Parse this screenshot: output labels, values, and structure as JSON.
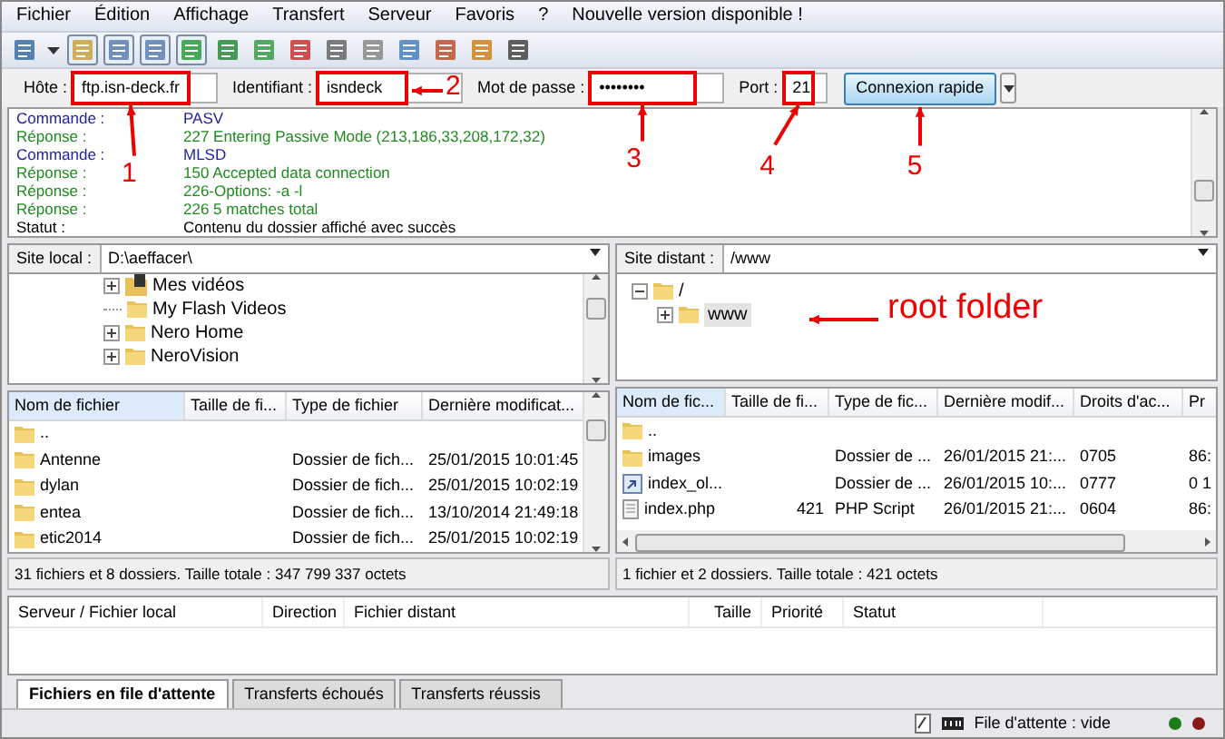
{
  "menu": [
    "Fichier",
    "Édition",
    "Affichage",
    "Transfert",
    "Serveur",
    "Favoris",
    "?",
    "Nouvelle version disponible !"
  ],
  "toolbar": [
    {
      "kind": "sitemanager",
      "on": false
    },
    {
      "kind": "dropdown",
      "on": false
    },
    {
      "kind": "log",
      "on": true
    },
    {
      "kind": "tree",
      "on": true
    },
    {
      "kind": "remotetree",
      "on": true
    },
    {
      "kind": "queue",
      "on": true
    },
    {
      "kind": "refresh",
      "on": false
    },
    {
      "kind": "process",
      "on": false
    },
    {
      "kind": "stop",
      "on": false
    },
    {
      "kind": "disconnect",
      "on": false
    },
    {
      "kind": "reconnect",
      "on": false
    },
    {
      "kind": "filter",
      "on": false
    },
    {
      "kind": "compare",
      "on": false
    },
    {
      "kind": "sync",
      "on": false
    },
    {
      "kind": "find",
      "on": false
    }
  ],
  "quickconnect": {
    "host": {
      "label": "Hôte :",
      "value": "ftp.isn-deck.fr"
    },
    "user": {
      "label": "Identifiant :",
      "value": "isndeck"
    },
    "password": {
      "label": "Mot de passe :",
      "value": "••••••••"
    },
    "port": {
      "label": "Port :",
      "value": "21"
    },
    "button": "Connexion rapide"
  },
  "log": [
    {
      "kind": "command",
      "label": "Commande :",
      "text": "PASV"
    },
    {
      "kind": "response",
      "label": "Réponse :",
      "text": "227 Entering Passive Mode (213,186,33,208,172,32)"
    },
    {
      "kind": "command",
      "label": "Commande :",
      "text": "MLSD"
    },
    {
      "kind": "response",
      "label": "Réponse :",
      "text": "150 Accepted data connection"
    },
    {
      "kind": "response",
      "label": "Réponse :",
      "text": "226-Options: -a -l"
    },
    {
      "kind": "response",
      "label": "Réponse :",
      "text": "226 5 matches total"
    },
    {
      "kind": "status",
      "label": "Statut :",
      "text": "Contenu du dossier affiché avec succès"
    }
  ],
  "local": {
    "site_label": "Site local :",
    "path": "D:\\aeffacer\\",
    "tree": [
      {
        "label": "Mes vidéos",
        "kind": "media",
        "expandable": true
      },
      {
        "label": "My Flash Videos",
        "kind": "folder",
        "expandable": false
      },
      {
        "label": "Nero Home",
        "kind": "folder",
        "expandable": true
      },
      {
        "label": "NeroVision",
        "kind": "folder",
        "expandable": true
      }
    ],
    "columns": [
      "Nom de fichier",
      "Taille de fi...",
      "Type de fichier",
      "Dernière modificat..."
    ],
    "rows": [
      {
        "kind": "folder",
        "cells": [
          "..",
          "",
          "",
          ""
        ]
      },
      {
        "kind": "folder",
        "cells": [
          "Antenne",
          "",
          "Dossier de fich...",
          "25/01/2015 10:01:45"
        ]
      },
      {
        "kind": "folder",
        "cells": [
          "dylan",
          "",
          "Dossier de fich...",
          "25/01/2015 10:02:19"
        ]
      },
      {
        "kind": "folder",
        "cells": [
          "entea",
          "",
          "Dossier de fich...",
          "13/10/2014 21:49:18"
        ]
      },
      {
        "kind": "folder",
        "cells": [
          "etic2014",
          "",
          "Dossier de fich...",
          "25/01/2015 10:02:19"
        ]
      }
    ],
    "summary": "31 fichiers et 8 dossiers. Taille totale : 347 799 337 octets"
  },
  "remote": {
    "site_label": "Site distant :",
    "path": "/www",
    "tree": [
      {
        "label": "/",
        "expanded": true,
        "selected": false,
        "children": [
          {
            "label": "www",
            "expanded": false,
            "selected": true
          }
        ]
      }
    ],
    "columns": [
      "Nom de fic...",
      "Taille de fi...",
      "Type de fic...",
      "Dernière modif...",
      "Droits d'ac...",
      "Pr"
    ],
    "rows": [
      {
        "kind": "folder",
        "cells": [
          "..",
          "",
          "",
          "",
          "",
          ""
        ]
      },
      {
        "kind": "folder",
        "cells": [
          "images",
          "",
          "Dossier de ...",
          "26/01/2015 21:...",
          "0705",
          "86:"
        ]
      },
      {
        "kind": "link",
        "cells": [
          "index_ol...",
          "",
          "Dossier de ...",
          "26/01/2015 10:...",
          "0777",
          "0 1"
        ]
      },
      {
        "kind": "file",
        "cells": [
          "index.php",
          "421",
          "PHP Script",
          "26/01/2015 21:...",
          "0604",
          "86:"
        ]
      }
    ],
    "summary": "1 fichier et 2 dossiers. Taille totale : 421 octets"
  },
  "queue": {
    "columns": [
      "Serveur / Fichier local",
      "Direction",
      "Fichier distant",
      "Taille",
      "Priorité",
      "Statut"
    ],
    "tabs": [
      {
        "label": "Fichiers en file d'attente",
        "selected": true
      },
      {
        "label": "Transferts échoués",
        "selected": false
      },
      {
        "label": "Transferts réussis",
        "selected": false
      }
    ]
  },
  "status_bar": {
    "queue": "File d'attente : vide"
  },
  "annotations": [
    {
      "label": "1"
    },
    {
      "label": "2"
    },
    {
      "label": "3"
    },
    {
      "label": "4"
    },
    {
      "label": "5"
    },
    {
      "label": "root folder"
    }
  ]
}
